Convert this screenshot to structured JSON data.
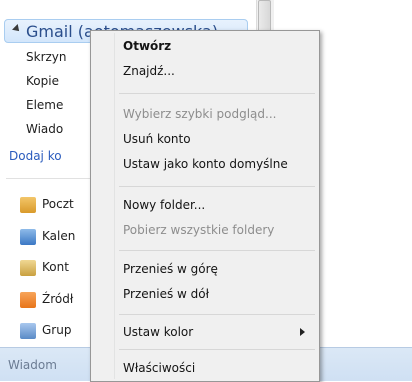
{
  "nav": {
    "account_title": "Gmail (aotomaszewska)",
    "folders": [
      "Skrzyn",
      "Kopie",
      "Eleme",
      "Wiado"
    ],
    "add_account": "Dodaj ko",
    "modules": [
      {
        "label": "Poczt",
        "icon": "mail-icon",
        "color": "#d99a2b"
      },
      {
        "label": "Kalen",
        "icon": "calendar-icon",
        "color": "#3b78c4"
      },
      {
        "label": "Kont",
        "icon": "contacts-icon",
        "color": "#c9a040"
      },
      {
        "label": "Źródł",
        "icon": "rss-feed-icon",
        "color": "#e8751a"
      },
      {
        "label": "Grup",
        "icon": "newsgroup-icon",
        "color": "#5a8ac6"
      }
    ],
    "status": "Wiadom"
  },
  "context_menu": {
    "items": {
      "open": "Otwórz",
      "find": "Znajdź...",
      "quick_view": "Wybierz szybki podgląd...",
      "delete_account": "Usuń konto",
      "set_default": "Ustaw jako konto domyślne",
      "new_folder": "Nowy folder...",
      "download_folders": "Pobierz wszystkie foldery",
      "move_up": "Przenieś w górę",
      "move_down": "Przenieś w dół",
      "set_color": "Ustaw kolor",
      "properties": "Właściwości"
    }
  }
}
